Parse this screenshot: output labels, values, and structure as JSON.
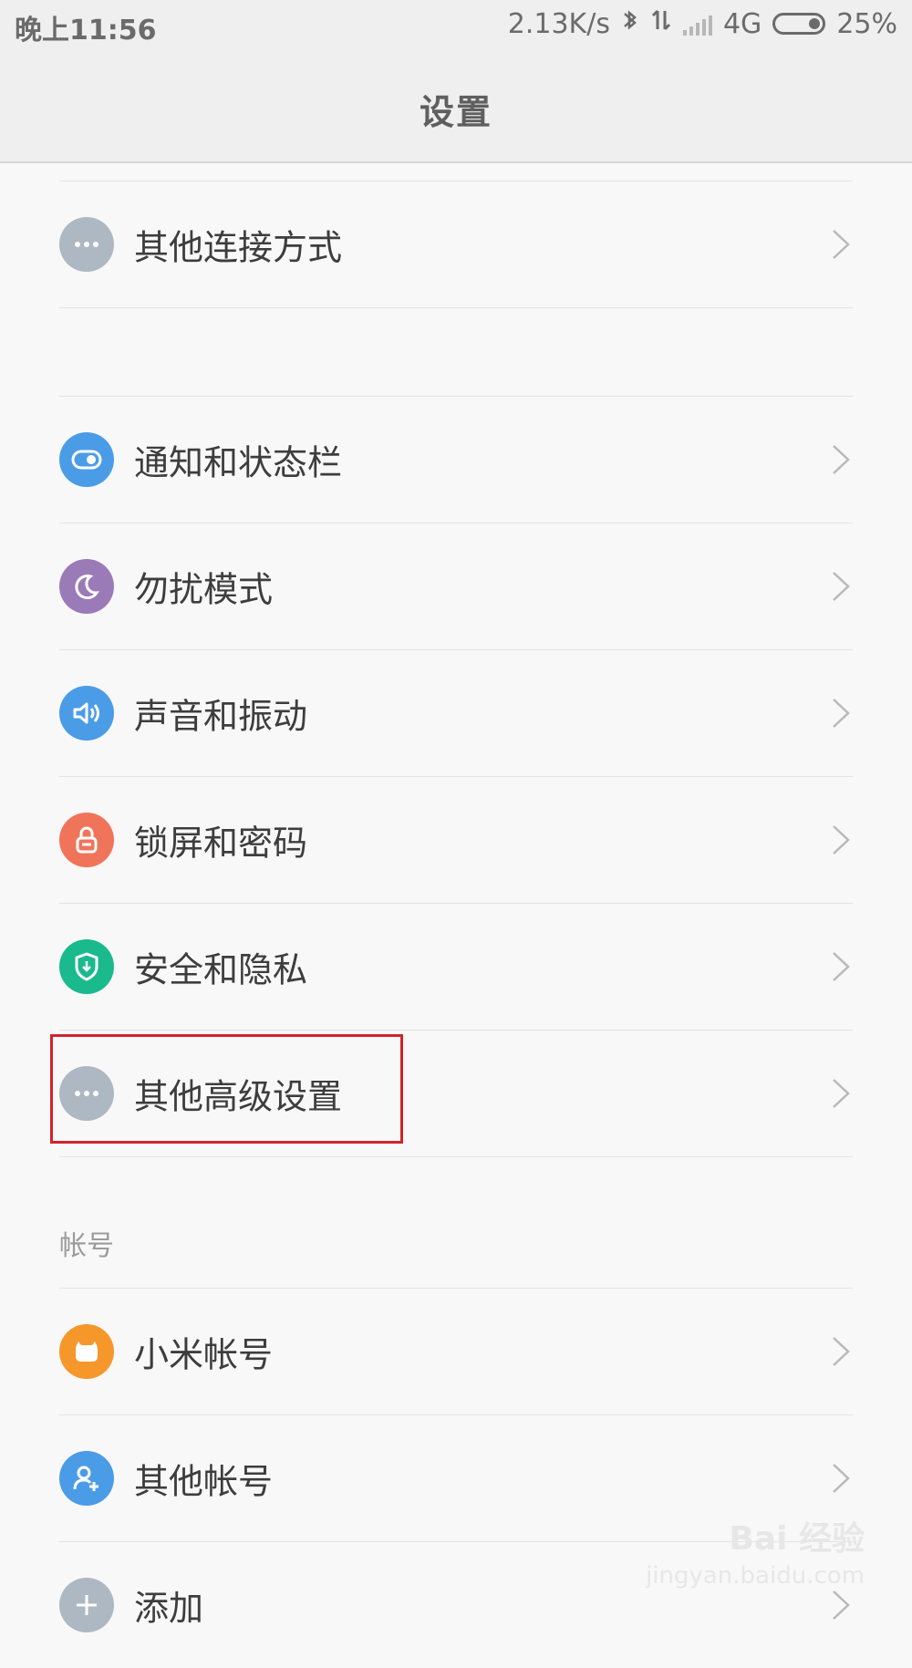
{
  "status_bar": {
    "time": "晚上11:56",
    "speed": "2.13K/s",
    "network": "4G",
    "battery": "25%",
    "icons": [
      "bluetooth-icon",
      "data-transfer-icon",
      "signal-icon",
      "battery-icon"
    ]
  },
  "header": {
    "title": "设置"
  },
  "sections": {
    "connect": {
      "items": [
        {
          "label": "其他连接方式",
          "icon": "more-dots-icon",
          "color": "#aeb8c2"
        }
      ]
    },
    "system": {
      "items": [
        {
          "label": "通知和状态栏",
          "icon": "toggle-icon",
          "color": "#4b9ce6"
        },
        {
          "label": "勿扰模式",
          "icon": "moon-icon",
          "color": "#9b7ab8"
        },
        {
          "label": "声音和振动",
          "icon": "speaker-icon",
          "color": "#4b9ce6"
        },
        {
          "label": "锁屏和密码",
          "icon": "lock-icon",
          "color": "#f0745a"
        },
        {
          "label": "安全和隐私",
          "icon": "shield-icon",
          "color": "#1aba8d"
        },
        {
          "label": "其他高级设置",
          "icon": "more-dots-icon",
          "color": "#aeb8c2"
        }
      ]
    },
    "account": {
      "title": "帐号",
      "items": [
        {
          "label": "小米帐号",
          "icon": "mi-account-icon",
          "color": "#f6972c"
        },
        {
          "label": "其他帐号",
          "icon": "user-add-icon",
          "color": "#4b9ce6"
        },
        {
          "label": "添加",
          "icon": "plus-icon",
          "color": "#aeb8c2"
        }
      ]
    }
  },
  "watermark": {
    "brand": "Bai 经验",
    "url": "jingyan.baidu.com"
  }
}
